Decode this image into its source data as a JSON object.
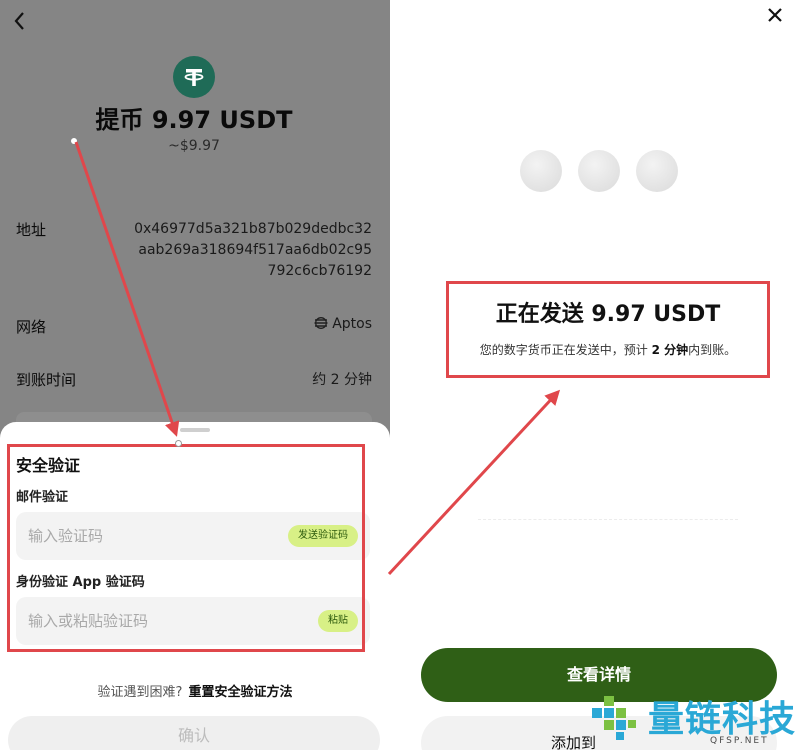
{
  "left": {
    "back_icon": "chevron-left-icon",
    "token_icon": "tether-icon",
    "title": "提币 9.97 USDT",
    "usd_value": "~$9.97",
    "address": {
      "label": "地址",
      "lines": [
        "0x46977d5a321b87b029dedbc32",
        "aab269a318694f517aa6db02c95",
        "792c6cb76192"
      ]
    },
    "network": {
      "label": "网络",
      "value": "Aptos",
      "icon": "aptos-icon"
    },
    "arrival": {
      "label": "到账时间",
      "value": "约 2 分钟"
    },
    "sheet": {
      "title": "安全验证",
      "email_label": "邮件验证",
      "email_placeholder": "输入验证码",
      "send_code_label": "发送验证码",
      "app_label": "身份验证 App 验证码",
      "app_placeholder": "输入或粘贴验证码",
      "paste_label": "粘贴",
      "trouble_text": "验证遇到困难?",
      "reset_link": "重置安全验证方法",
      "confirm_label": "确认"
    }
  },
  "right": {
    "close_icon": "close-icon",
    "sending_title": "正在发送 9.97 USDT",
    "sending_desc_pre": "您的数字货币正在发送中，预计",
    "sending_desc_bold": "2 分钟",
    "sending_desc_post": "内到账。",
    "view_details_label": "查看详情",
    "add_label": "添加到"
  },
  "watermark": {
    "text": "量链科技",
    "sub": "QFSP.NET"
  },
  "colors": {
    "highlight": "#e0474b",
    "primary_button": "#2f5f16",
    "pill": "#d8f086",
    "token": "#1f6b57",
    "watermark": "#2aa8d6"
  }
}
